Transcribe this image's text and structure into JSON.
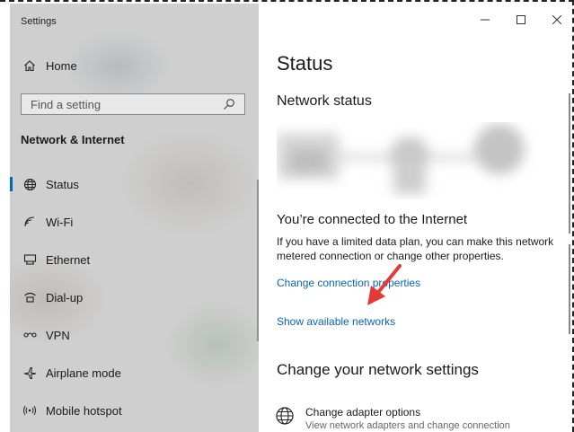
{
  "sidebar": {
    "app_title": "Settings",
    "home_label": "Home",
    "search": {
      "placeholder": "Find a setting"
    },
    "section_title": "Network & Internet",
    "items": [
      {
        "label": "Status",
        "icon": "globe-icon",
        "active": true
      },
      {
        "label": "Wi-Fi",
        "icon": "wifi-icon"
      },
      {
        "label": "Ethernet",
        "icon": "ethernet-icon"
      },
      {
        "label": "Dial-up",
        "icon": "dialup-icon"
      },
      {
        "label": "VPN",
        "icon": "vpn-icon"
      },
      {
        "label": "Airplane mode",
        "icon": "airplane-icon"
      },
      {
        "label": "Mobile hotspot",
        "icon": "hotspot-icon"
      }
    ]
  },
  "window": {
    "minimize": "—",
    "maximize": "☐",
    "close": "✕"
  },
  "main": {
    "page_title": "Status",
    "network_status_heading": "Network status",
    "connected_heading": "You’re connected to the Internet",
    "description_line1": "If you have a limited data plan, you can make this network",
    "description_line2": "metered connection or change other properties.",
    "change_connection_link": "Change connection properties",
    "show_networks_link": "Show available networks",
    "change_settings_heading": "Change your network settings",
    "adapter_option": {
      "title": "Change adapter options",
      "subtitle": "View network adapters and change connection"
    }
  },
  "colors": {
    "accent": "#0067c0",
    "link": "#0a63b8",
    "annotation_arrow": "#e53935"
  }
}
